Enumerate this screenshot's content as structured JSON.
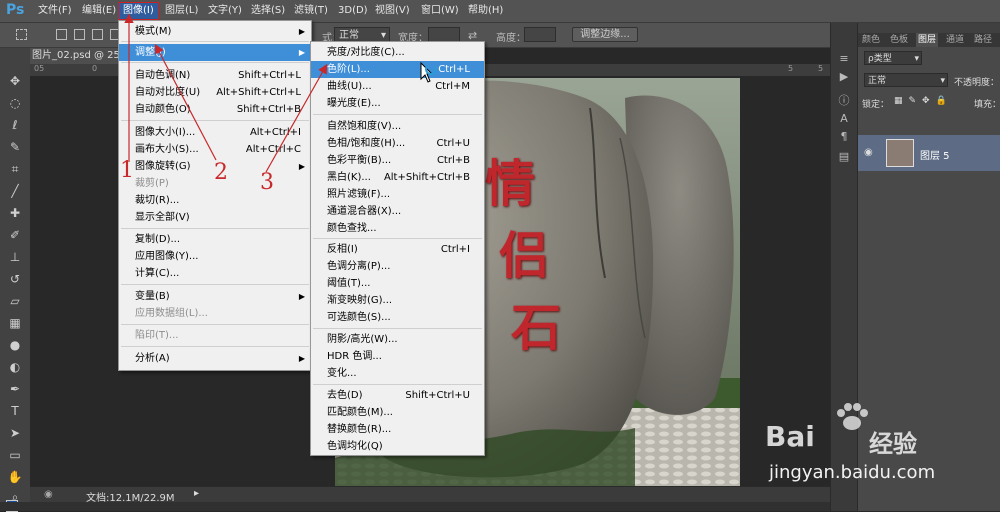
{
  "app": {
    "logo": "Ps"
  },
  "menubar": {
    "items": [
      {
        "label": "文件(F)"
      },
      {
        "label": "编辑(E)"
      },
      {
        "label": "图像(I)"
      },
      {
        "label": "图层(L)"
      },
      {
        "label": "文字(Y)"
      },
      {
        "label": "选择(S)"
      },
      {
        "label": "滤镜(T)"
      },
      {
        "label": "3D(D)"
      },
      {
        "label": "视图(V)"
      },
      {
        "label": "窗口(W)"
      },
      {
        "label": "帮助(H)"
      }
    ]
  },
  "options": {
    "style_label": "式：",
    "style_value": "正常",
    "width_label": "宽度：",
    "height_label": "高度：",
    "refine_edge": "调整边缘..."
  },
  "document": {
    "tab": "图片_02.psd @ 25% (",
    "ruler": [
      "05",
      "0",
      "5",
      "5"
    ],
    "status": "文档:12.1M/22.9M"
  },
  "image_menu": {
    "items": [
      {
        "label": "模式(M)",
        "shortcut": "",
        "arrow": true,
        "disabled": false
      },
      {
        "label": "调整(J)",
        "shortcut": "",
        "arrow": true,
        "disabled": false,
        "highlighted": true
      },
      {
        "label": "自动色调(N)",
        "shortcut": "Shift+Ctrl+L"
      },
      {
        "label": "自动对比度(U)",
        "shortcut": "Alt+Shift+Ctrl+L"
      },
      {
        "label": "自动颜色(O)",
        "shortcut": "Shift+Ctrl+B"
      },
      {
        "label": "图像大小(I)...",
        "shortcut": "Alt+Ctrl+I"
      },
      {
        "label": "画布大小(S)...",
        "shortcut": "Alt+Ctrl+C"
      },
      {
        "label": "图像旋转(G)",
        "shortcut": "",
        "arrow": true
      },
      {
        "label": "裁剪(P)",
        "shortcut": "",
        "disabled": true
      },
      {
        "label": "裁切(R)...",
        "shortcut": ""
      },
      {
        "label": "显示全部(V)",
        "shortcut": ""
      },
      {
        "label": "复制(D)...",
        "shortcut": ""
      },
      {
        "label": "应用图像(Y)...",
        "shortcut": ""
      },
      {
        "label": "计算(C)...",
        "shortcut": ""
      },
      {
        "label": "变量(B)",
        "shortcut": "",
        "arrow": true
      },
      {
        "label": "应用数据组(L)...",
        "shortcut": "",
        "disabled": true
      },
      {
        "label": "陷印(T)...",
        "shortcut": "",
        "disabled": true
      },
      {
        "label": "分析(A)",
        "shortcut": "",
        "arrow": true
      }
    ]
  },
  "adjust_menu": {
    "items": [
      {
        "label": "亮度/对比度(C)...",
        "shortcut": ""
      },
      {
        "label": "色阶(L)...",
        "shortcut": "Ctrl+L",
        "highlighted": true
      },
      {
        "label": "曲线(U)...",
        "shortcut": "Ctrl+M"
      },
      {
        "label": "曝光度(E)...",
        "shortcut": ""
      },
      {
        "label": "自然饱和度(V)...",
        "shortcut": ""
      },
      {
        "label": "色相/饱和度(H)...",
        "shortcut": "Ctrl+U"
      },
      {
        "label": "色彩平衡(B)...",
        "shortcut": "Ctrl+B"
      },
      {
        "label": "黑白(K)...",
        "shortcut": "Alt+Shift+Ctrl+B"
      },
      {
        "label": "照片滤镜(F)...",
        "shortcut": ""
      },
      {
        "label": "通道混合器(X)...",
        "shortcut": ""
      },
      {
        "label": "颜色查找...",
        "shortcut": ""
      },
      {
        "label": "反相(I)",
        "shortcut": "Ctrl+I"
      },
      {
        "label": "色调分离(P)...",
        "shortcut": ""
      },
      {
        "label": "阈值(T)...",
        "shortcut": ""
      },
      {
        "label": "渐变映射(G)...",
        "shortcut": ""
      },
      {
        "label": "可选颜色(S)...",
        "shortcut": ""
      },
      {
        "label": "阴影/高光(W)...",
        "shortcut": ""
      },
      {
        "label": "HDR 色调...",
        "shortcut": ""
      },
      {
        "label": "变化...",
        "shortcut": ""
      },
      {
        "label": "去色(D)",
        "shortcut": "Shift+Ctrl+U"
      },
      {
        "label": "匹配颜色(M)...",
        "shortcut": ""
      },
      {
        "label": "替换颜色(R)...",
        "shortcut": ""
      },
      {
        "label": "色调均化(Q)",
        "shortcut": ""
      }
    ]
  },
  "annotations": {
    "one": "1",
    "two": "2",
    "three": "3",
    "color": "#c8282a"
  },
  "photo": {
    "carved_text": [
      "情",
      "侣",
      "石"
    ],
    "carved_color": "#c0272d"
  },
  "panels": {
    "tabs": [
      "颜色",
      "色板",
      "图层",
      "通道",
      "路径"
    ],
    "kind_label": "ρ类型",
    "blend_mode": "正常",
    "opacity_label": "不透明度：",
    "lock_label": "锁定：",
    "fill_label": "填充：",
    "layer_name": "图层 5"
  },
  "watermark": {
    "brand": "Bai",
    "brand_cn": "经验",
    "url": "jingyan.baidu.com"
  },
  "colors": {
    "menu_highlight": "#3f8fd8",
    "ui_dark": "#535353"
  }
}
